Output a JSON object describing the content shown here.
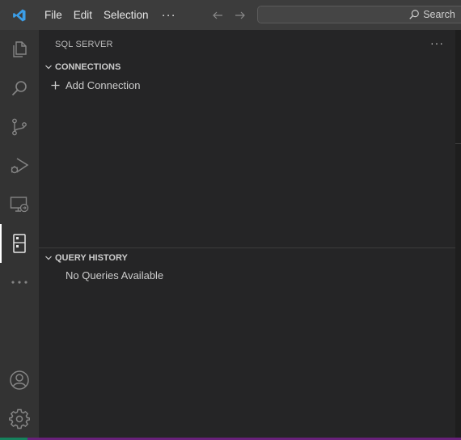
{
  "menu": {
    "file": "File",
    "edit": "Edit",
    "selection": "Selection",
    "more": "···"
  },
  "search": {
    "label": "Search"
  },
  "activity_bar": {
    "items": [
      "explorer-icon",
      "search-icon",
      "source-control-icon",
      "run-debug-icon",
      "remote-explorer-icon",
      "sql-server-icon",
      "more-icon",
      "accounts-icon",
      "settings-gear-icon"
    ],
    "active": "sql-server-icon"
  },
  "sidebar": {
    "title": "SQL SERVER",
    "more": "···",
    "connections": {
      "title": "CONNECTIONS",
      "add_label": "Add Connection"
    },
    "query_history": {
      "title": "QUERY HISTORY",
      "empty_label": "No Queries Available"
    }
  },
  "colors": {
    "accent_logo": "#3b9ee8",
    "status_bar": "#68217a"
  }
}
